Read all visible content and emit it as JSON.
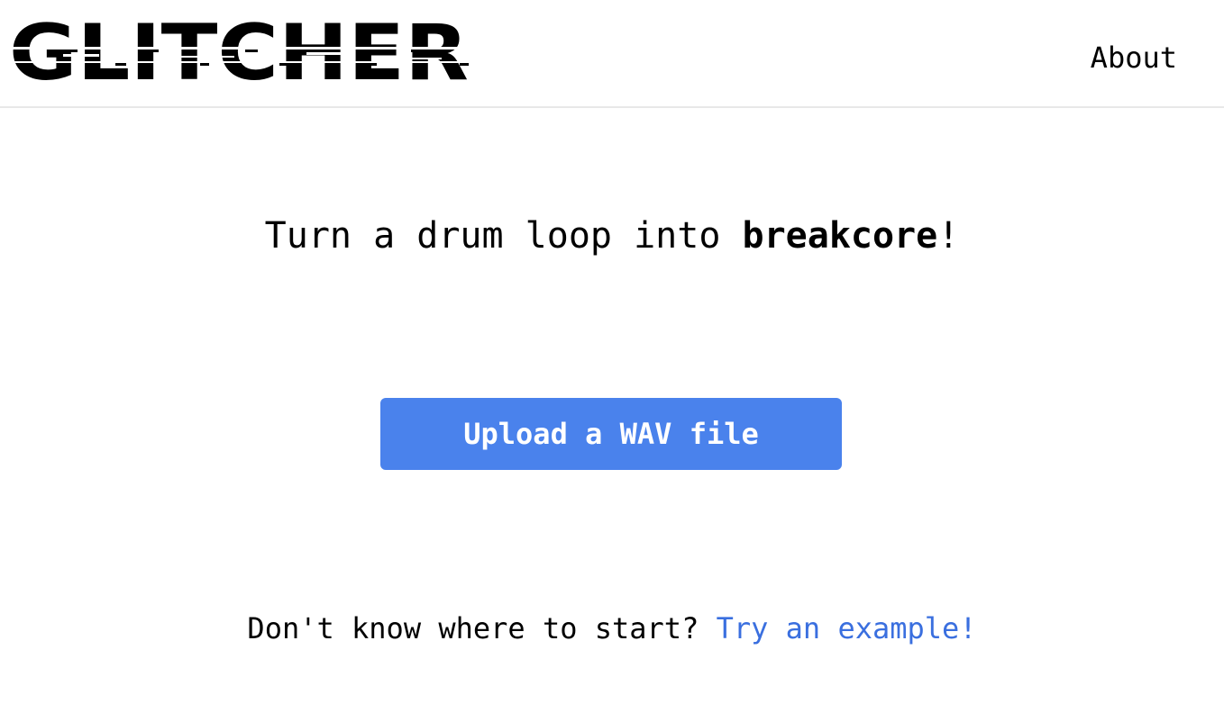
{
  "header": {
    "logo_text": "GLITCHER",
    "nav": {
      "about_label": "About"
    }
  },
  "main": {
    "tagline": {
      "prefix": "Turn a drum loop into ",
      "emphasis": "breakcore",
      "suffix": "!"
    },
    "upload_button_label": "Upload a WAV file",
    "example": {
      "prompt": "Don't know where to start? ",
      "link_label": "Try an example!"
    }
  },
  "colors": {
    "button_bg": "#4a82ec",
    "button_text": "#ffffff",
    "link": "#3a6fdf",
    "text": "#000000",
    "divider": "#e8e8e8"
  }
}
